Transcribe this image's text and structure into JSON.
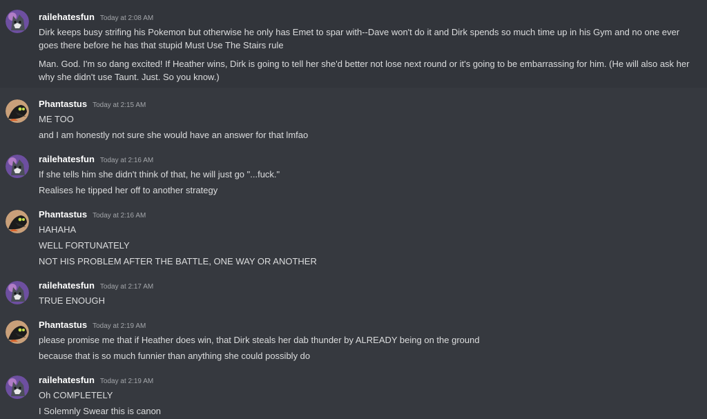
{
  "messages": [
    {
      "user": "railehatesfun",
      "avatar": "cat-avatar-icon",
      "time": "Today at 2:08 AM",
      "lines": [
        "Dirk keeps busy strifing his Pokemon but otherwise he only has Emet to spar with--Dave won't do it and Dirk spends so much time up in his Gym and no one ever goes there before he has that stupid Must Use The Stairs rule",
        "Man. God. I'm so dang excited! If Heather wins, Dirk is going to tell her she'd better not lose next round or it's going to be embarrassing for him. (He will also ask her why she didn't use Taunt. Just. So you know.)"
      ]
    },
    {
      "user": "Phantastus",
      "avatar": "bird-avatar-icon",
      "time": "Today at 2:15 AM",
      "lines": [
        "ME TOO",
        "and I am honestly not sure she would have an answer for that lmfao"
      ]
    },
    {
      "user": "railehatesfun",
      "avatar": "cat-avatar-icon",
      "time": "Today at 2:16 AM",
      "lines": [
        "If she tells him she didn't think of that, he will just go \"...fuck.\"",
        "Realises he tipped her off to another strategy"
      ]
    },
    {
      "user": "Phantastus",
      "avatar": "bird-avatar-icon",
      "time": "Today at 2:16 AM",
      "lines": [
        "HAHAHA",
        "WELL FORTUNATELY",
        "NOT HIS PROBLEM AFTER THE BATTLE, ONE WAY OR ANOTHER"
      ]
    },
    {
      "user": "railehatesfun",
      "avatar": "cat-avatar-icon",
      "time": "Today at 2:17 AM",
      "lines": [
        "TRUE ENOUGH"
      ]
    },
    {
      "user": "Phantastus",
      "avatar": "bird-avatar-icon",
      "time": "Today at 2:19 AM",
      "lines": [
        "please promise me that if Heather does win, that Dirk steals her dab thunder by ALREADY being on the ground",
        "because that is so much funnier than anything she could possibly do"
      ]
    },
    {
      "user": "railehatesfun",
      "avatar": "cat-avatar-icon",
      "time": "Today at 2:19 AM",
      "lines": [
        "Oh COMPLETELY",
        "I Solemnly Swear this is canon"
      ]
    }
  ]
}
